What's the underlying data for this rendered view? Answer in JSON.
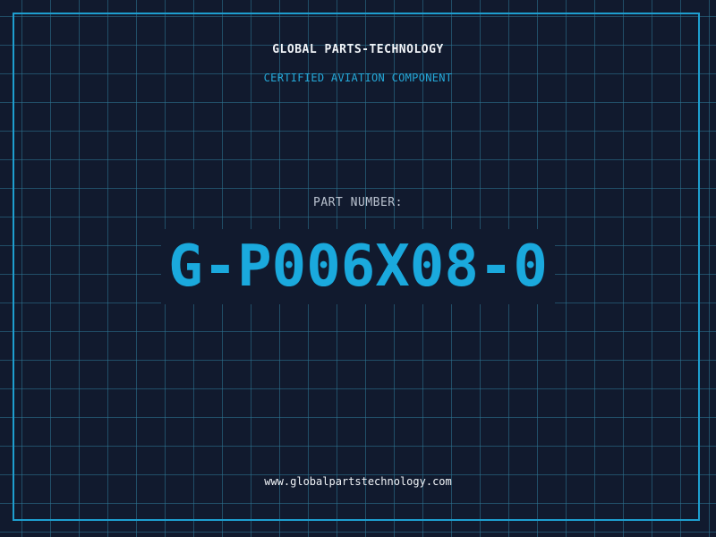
{
  "header": {
    "company": "GLOBAL PARTS-TECHNOLOGY",
    "tagline": "CERTIFIED AVIATION COMPONENT"
  },
  "part": {
    "label": "PART NUMBER:",
    "number": "G-P006X08-0"
  },
  "footer": {
    "website": "www.globalpartstechnology.com"
  },
  "colors": {
    "background": "#111a2e",
    "grid": "#2e7896",
    "accent": "#1e9ecf",
    "text": "#f1f4f8"
  }
}
